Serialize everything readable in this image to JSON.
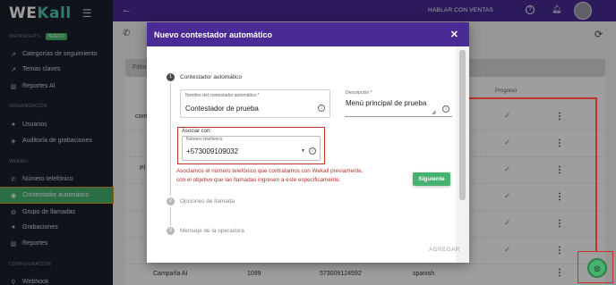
{
  "app": {
    "brand_main": "WE",
    "brand_accent": "Kall"
  },
  "sidebar": {
    "sections": [
      {
        "title": "WEINSIGHTS",
        "badge": "NUEVO"
      },
      {
        "title": "ORGANIZACIÓN"
      },
      {
        "title": "WEKALL"
      },
      {
        "title": "CONFIGURACIÓN"
      }
    ],
    "items": [
      {
        "label": "Categorías de seguimiento",
        "icon": "trend-icon"
      },
      {
        "label": "Temas claves",
        "icon": "trend-icon"
      },
      {
        "label": "Reportes AI",
        "icon": "chart-icon"
      },
      {
        "label": "Usuarios",
        "icon": "users-icon"
      },
      {
        "label": "Auditoría de grabaciones",
        "icon": "audit-icon"
      },
      {
        "label": "Número telefónico",
        "icon": "phone-icon"
      },
      {
        "label": "Contestador automático",
        "icon": "robot-icon",
        "active": true
      },
      {
        "label": "Grupo de llamadas",
        "icon": "group-icon"
      },
      {
        "label": "Grabaciones",
        "icon": "mic-icon"
      },
      {
        "label": "Reportes",
        "icon": "chart-icon"
      },
      {
        "label": "Webhook",
        "icon": "webhook-icon"
      }
    ]
  },
  "topbar": {
    "cta": "HABLAR CON VENTAS"
  },
  "background": {
    "filter_label": "Filtro",
    "col_progreso": "Progreso",
    "row_labels": [
      "conte",
      "Pl"
    ],
    "bottom_row": {
      "name": "Campaña AI",
      "ext": "1099",
      "number": "573009124592",
      "language": "spanish"
    }
  },
  "modal": {
    "title": "Nuevo contestador automático",
    "steps": [
      {
        "num": "1",
        "label": "Contestador automático"
      },
      {
        "num": "2",
        "label": "Opciones de llamada"
      },
      {
        "num": "3",
        "label": "Mensaje de la operadora"
      }
    ],
    "name_field": {
      "label": "Nombre del contestador automático *",
      "value": "Contestador de prueba"
    },
    "description_field": {
      "label": "Descripción *",
      "value": "Menú principal de prueba"
    },
    "associate": {
      "label": "Asociar con:",
      "field_label": "Número telefónico",
      "value": "+573009109032"
    },
    "annotation": "Asociamos el número telefónico que contratamos con Wekall previamente, con el objetivo que las llamadas ingresen a este específicamente.",
    "next_button": "Siguiente",
    "add_button": "AGREGAR"
  },
  "colors": {
    "brand_purple": "#4a2b96",
    "accent_green": "#45b26f",
    "annotation_red": "#c0342b",
    "sidebar_bg": "#1c1f2b"
  }
}
